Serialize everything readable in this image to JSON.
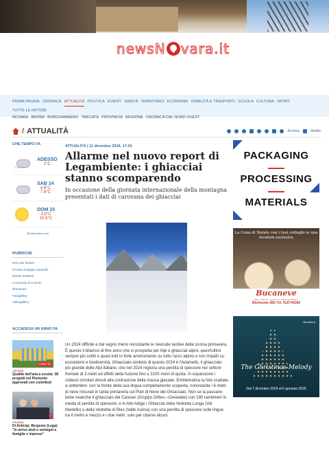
{
  "site": {
    "logo_part1": "newsN",
    "logo_part2": "vara.it"
  },
  "nav": {
    "items": [
      "PRIMA PAGINA",
      "CRONACA",
      "ATTUALITÀ",
      "POLITICA",
      "EVENTI",
      "SANITÀ",
      "TERRITORIO",
      "ECONOMIA",
      "VIABILITÀ E TRASPORTI",
      "SCUOLA",
      "CULTURA",
      "SPORT"
    ],
    "row2": "TUTTE LE NOTIZIE",
    "sub": [
      "NOVARA",
      "ARONA",
      "BORGOMANERO",
      "TRECATE",
      "PROVINCIA",
      "REGIONE",
      "CRONACA DAL NORD OVEST"
    ]
  },
  "section": {
    "sep": "/",
    "title": "ATTUALITÀ",
    "archivio": "Archivio",
    "mobile": "Mobile"
  },
  "weather": {
    "heading": "CHE TEMPO FA",
    "days": [
      {
        "label": "ADESSO",
        "t1": "1°C",
        "t2": "",
        "icon": "fog-icon",
        "small": "FOSCHIA"
      },
      {
        "label": "SAB 14",
        "t1": "4.6°C",
        "t2": "7.8°C",
        "icon": "cloud-icon"
      },
      {
        "label": "DOM 15",
        "t1": "3.8°C",
        "t2": "10.6°C",
        "icon": "sun-icon"
      }
    ],
    "credit": "@Datameteo.com"
  },
  "rubriche": {
    "heading": "RUBRICHE",
    "items": [
      "Non solo fumetti",
      "Il Punto di Beppe Gandolfo",
      "Mondo Studenti",
      "L'oroscopo di Corinne",
      "Itinerarium",
      "Fotogallery",
      "Videogallery"
    ]
  },
  "accadeva": {
    "heading": "ACCADEVA UN ANNO FA",
    "items": [
      {
        "badge": "1 ANNO FA",
        "category": "Attualità",
        "title": "Qualità dell'aria a scuola: 38 progetti nel Piemonte approvati con contributi"
      },
      {
        "badge": "1 ANNO FA",
        "category": "Attualità",
        "title": "Di Anticipi, Bergesio (Lega): \"In arrivo aiuti e sostegni a famiglie e imprese\""
      }
    ]
  },
  "article": {
    "meta": "ATTUALITÀ | 11 dicembre 2024, 17:01",
    "title": "Allarme nel nuovo report di Legambiente: i ghiacciai stanno scomparendo",
    "subtitle": "In occasione della giornata internazionale della montagna presentati i dati di carovana dei ghiacciai",
    "body": "Un 2024 difficile e dal segno meno nonostante le nevicate tardive della scorsa primavera. È questo il bilancio di fine anno che si prospetta per Alpi e ghiacciai alpini, quest'ultimi sempre più sottili e quasi tutti in forte arretramento su tutto l'arco alpino e con impatti su ecosistemi e biodiversità. Ghiacciaio simbolo di questo 2024 è l'Adamello, il ghiacciaio più grande delle Alpi italiane, che nel 2024 registra una perdita di spessore nel settore frontale di 3 metri ed effetti della fusione fino a 3100 metri di quota. In espansione i collassi circolari dovuti alla contrazione della massa glaciale. Emblematica la foto scattata a settembre: con la fronte della sua lingua completamente scoperta, nonostante i 6 metri di neve misurati in tarda primavera sul Pian di Neve del Ghiacciaio. Non se la passano bene neanche il ghiacciaio del Careser (Gruppo Ortles—Cevedale) con 190 centimetri in media di perdita di spessore, e in Alto Adige i Ghiacciai della Vedretta Lunga (Val Martello) e della Vedretta di Ries (Valle Aurina) con una perdita di spessore sulle lingue tra il metro e mezzo e i due metri, solo per citarne alcuni."
  },
  "ads": {
    "packaging": [
      "PACKAGING",
      "PROCESSING",
      "MATERIALS"
    ],
    "bucaneve": {
      "head": "La Cena di Natale con i tuoi colleghi in una location esclusiva",
      "brand": "Bucaneve",
      "sub": "WELLNESS HOTEL & RESTAURANT",
      "addr": "Bielmonte (BI) Tel. 015744184"
    },
    "christmas": {
      "logo": "Nunaferra",
      "title": "The Christmas Melody",
      "dates": "Dal 7 dicembre 2024 al 6 gennaio 2025"
    }
  },
  "colors": {
    "accent": "#2d6da8",
    "brand_red": "#d32a2a"
  }
}
